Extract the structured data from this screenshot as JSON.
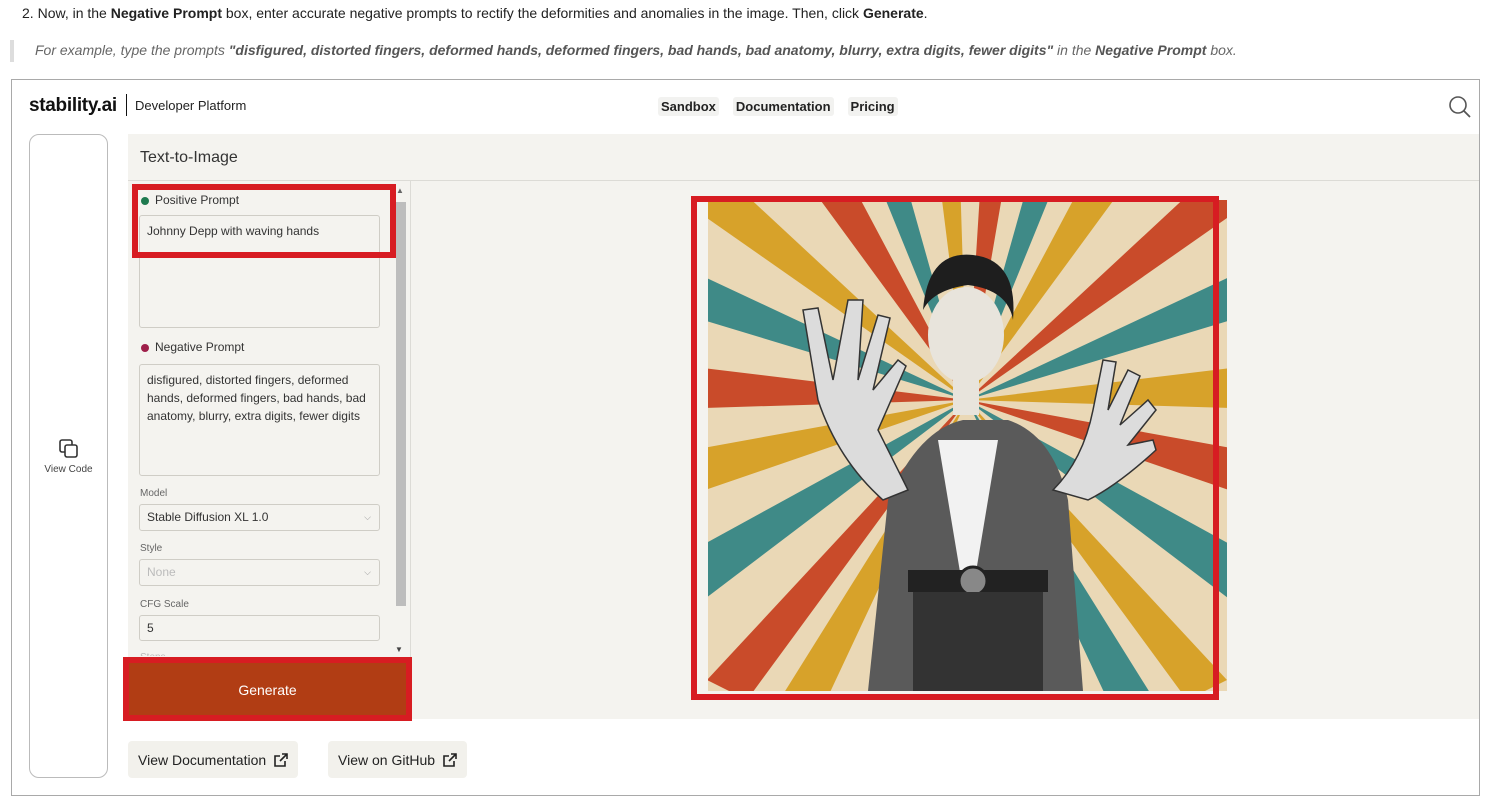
{
  "instructions": {
    "step_number": "2.",
    "step_pre": "Now, in the",
    "step_b1": "Negative Prompt",
    "step_mid": "box, enter accurate negative prompts to rectify the deformities and anomalies in the image. Then, click",
    "step_b2": "Generate",
    "step_post": ".",
    "note_pre": "For example, type the prompts",
    "note_b1": "\"disfigured, distorted fingers, deformed hands, deformed fingers, bad hands, bad anatomy, blurry, extra digits, fewer digits\"",
    "note_mid": "in the",
    "note_b2": "Negative Prompt",
    "note_post": "box."
  },
  "header": {
    "logo": "stability.ai",
    "subtitle": "Developer Platform",
    "nav": [
      "Sandbox",
      "Documentation",
      "Pricing"
    ],
    "search_icon": "search-icon"
  },
  "sidebar": {
    "view_code_label": "View Code",
    "view_code_icon": "copy-icon"
  },
  "panel": {
    "title": "Text-to-Image",
    "positive_label": "Positive Prompt",
    "positive_value": "Johnny Depp with waving hands",
    "negative_label": "Negative Prompt",
    "negative_value": "disfigured, distorted fingers, deformed hands, deformed fingers, bad hands, bad anatomy, blurry, extra digits, fewer digits",
    "model_label": "Model",
    "model_value": "Stable Diffusion XL 1.0",
    "style_label": "Style",
    "style_value": "None",
    "cfg_label": "CFG Scale",
    "cfg_value": "5",
    "steps_label": "Steps",
    "generate_label": "Generate"
  },
  "footer": {
    "view_docs": "View Documentation",
    "view_github": "View on GitHub",
    "external_icon": "external-link-icon"
  },
  "colors": {
    "accent": "#b13d14",
    "highlight": "#d71c22",
    "positive_dot": "#1e7a4f",
    "negative_dot": "#9e1f4a"
  }
}
